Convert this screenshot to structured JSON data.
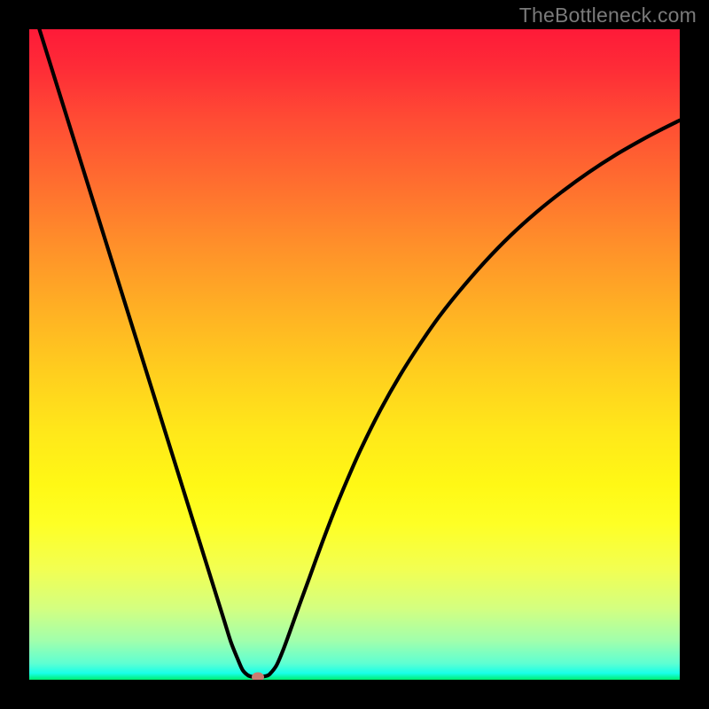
{
  "watermark": "TheBottleneck.com",
  "colors": {
    "curve": "#000000",
    "marker": "#c77e72",
    "frame": "#000000"
  },
  "chart_data": {
    "type": "line",
    "title": "",
    "xlabel": "",
    "ylabel": "",
    "xlim": [
      0,
      100
    ],
    "ylim": [
      0,
      100
    ],
    "x": [
      0,
      2,
      4,
      6,
      8,
      10,
      12,
      14,
      16,
      18,
      20,
      22,
      24,
      26,
      28,
      30,
      31,
      32,
      32.8,
      33.6,
      34.3,
      35,
      35.5,
      36,
      36.5,
      37,
      38,
      39,
      40,
      41.5,
      43,
      45,
      47,
      49,
      51,
      54,
      57,
      60,
      63,
      66,
      70,
      74,
      78,
      82,
      86,
      90,
      94,
      97,
      100
    ],
    "y": [
      105,
      98.6,
      92.2,
      85.8,
      79.4,
      73,
      66.6,
      60.2,
      53.8,
      47.4,
      41,
      34.6,
      28.2,
      21.8,
      15.4,
      9,
      5.8,
      3.3,
      1.5,
      0.7,
      0.45,
      0.45,
      0.45,
      0.5,
      0.6,
      0.9,
      2.2,
      4.5,
      7.2,
      11.4,
      15.5,
      21,
      26.2,
      31,
      35.5,
      41.5,
      46.8,
      51.5,
      55.8,
      59.6,
      64.2,
      68.3,
      71.9,
      75.1,
      78,
      80.6,
      82.9,
      84.5,
      86
    ],
    "marker": {
      "x": 35.2,
      "y": 0.45
    },
    "grid": false,
    "legend": false
  }
}
